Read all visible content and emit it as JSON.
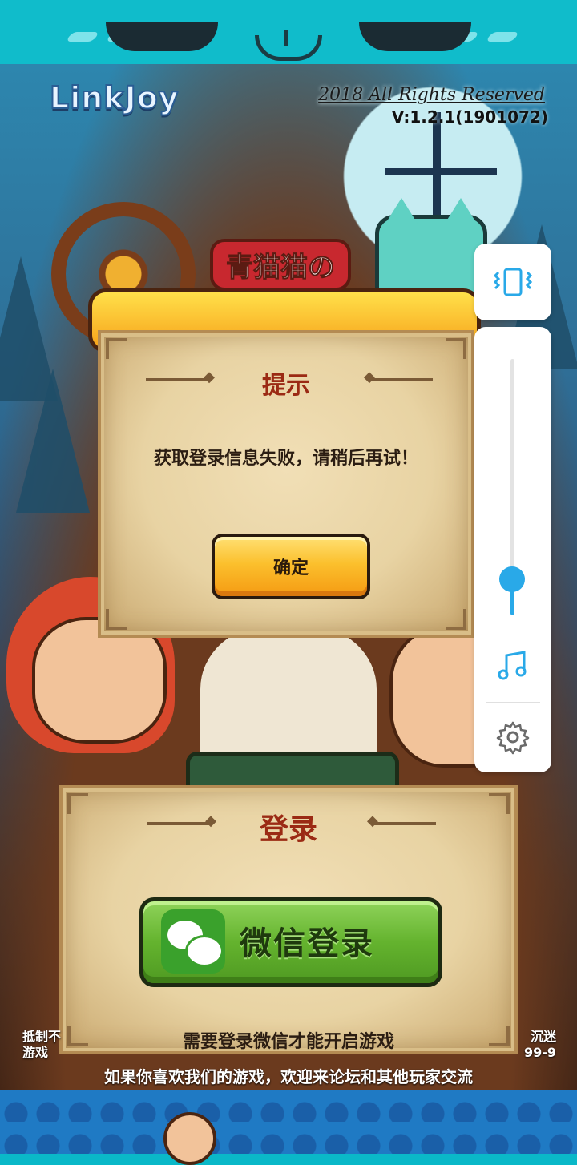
{
  "branding": {
    "logo_text": "LinkJoy",
    "copyright": "2018 All Rights Reserved",
    "version": "V:1.2.1(1901072)",
    "game_title_sub": "青猫猫の"
  },
  "dialog": {
    "title": "提示",
    "message": "获取登录信息失败，请稍后再试！",
    "confirm_label": "确定"
  },
  "login": {
    "title": "登录",
    "wechat_label": "微信登录",
    "hint": "需要登录微信才能开启游戏"
  },
  "side_panel": {
    "volume_level": 0.14,
    "icons": [
      "vibrate-icon",
      "music-icon",
      "gear-icon"
    ]
  },
  "notices": {
    "left_line1": "抵制不",
    "left_line2": "游戏",
    "right_line1": "沉迷",
    "right_line2": "99-9",
    "forum": "如果你喜欢我们的游戏，欢迎来论坛和其他玩家交流"
  },
  "colors": {
    "accent_blue": "#29a9e8",
    "title_red": "#9b2a14",
    "wechat_green": "#64b32e",
    "confirm_orange": "#fbc02d"
  }
}
